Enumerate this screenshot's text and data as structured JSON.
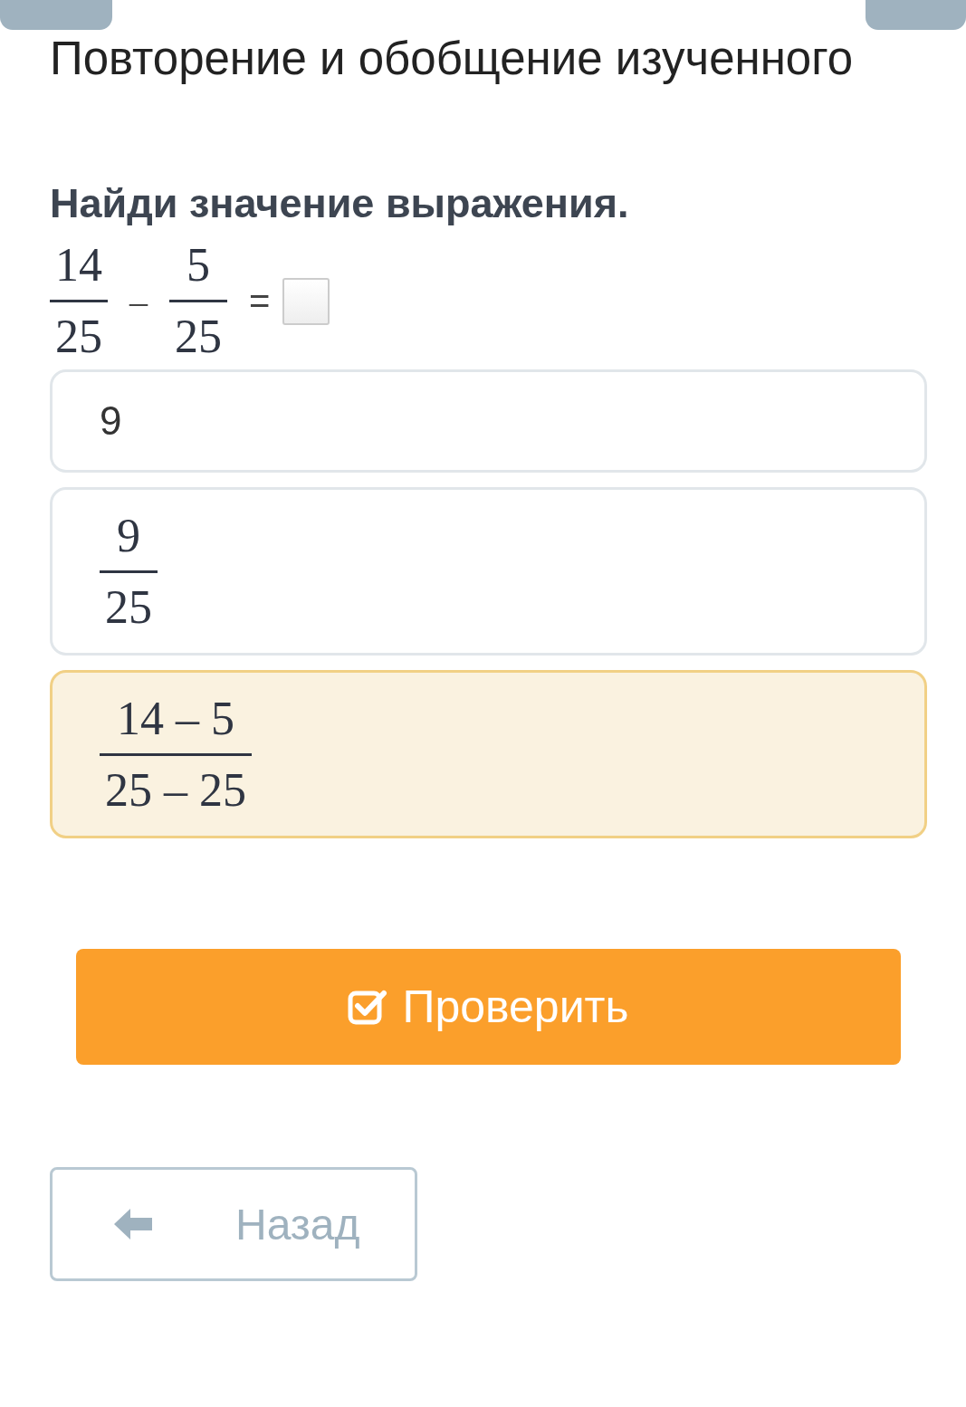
{
  "title": "Повторение и обобщение изученного",
  "question": "Найди значение выражения.",
  "expression": {
    "left": {
      "numerator": "14",
      "denominator": "25"
    },
    "operator": "–",
    "right": {
      "numerator": "5",
      "denominator": "25"
    },
    "equals": "="
  },
  "options": [
    {
      "kind": "text",
      "text": "9",
      "selected": false
    },
    {
      "kind": "fraction",
      "numerator": "9",
      "denominator": "25",
      "selected": false
    },
    {
      "kind": "fraction",
      "numerator": "14 – 5",
      "denominator": "25 – 25",
      "selected": true
    }
  ],
  "check_button": "Проверить",
  "back_button": "Назад"
}
